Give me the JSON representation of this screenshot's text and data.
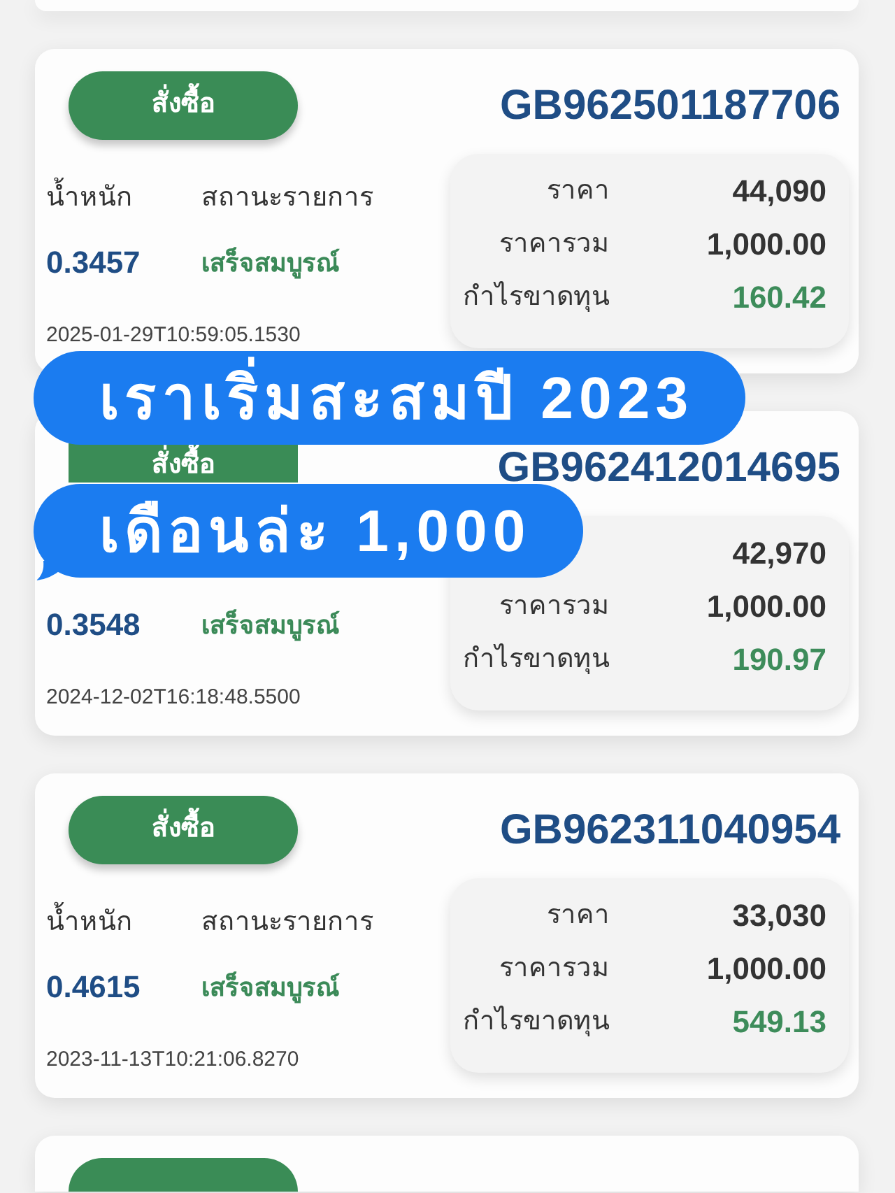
{
  "cards": [
    {
      "kind": "edge"
    },
    {
      "kind": "full",
      "button": "สั่งซื้อ",
      "order_id": "GB962501187706",
      "weight_label": "น้ำหนัก",
      "status_label": "สถานะรายการ",
      "weight": "0.3457",
      "status": "เสร็จสมบูรณ์",
      "timestamp": "2025-01-29T10:59:05.1530",
      "summary": [
        {
          "kind": "amount",
          "label": "ราคา",
          "value": "44,090"
        },
        {
          "kind": "amount",
          "label": "ราคารวม",
          "value": "1,000.00"
        },
        {
          "kind": "profit",
          "label": "กำไรขาดทุน",
          "value": "160.42"
        }
      ]
    },
    {
      "kind": "covered",
      "button": "สั่งซื้อ",
      "order_id": "GB962412014695",
      "weight": "0.3548",
      "status": "เสร็จสมบูรณ์",
      "timestamp": "2024-12-02T16:18:48.5500",
      "summary": [
        {
          "kind": "amount",
          "value": "42,970"
        },
        {
          "kind": "amount",
          "label": "ราคารวม",
          "value": "1,000.00"
        },
        {
          "kind": "profit",
          "label": "กำไรขาดทุน",
          "value": "190.97"
        }
      ]
    },
    {
      "kind": "full",
      "button": "สั่งซื้อ",
      "order_id": "GB962311040954",
      "weight_label": "น้ำหนัก",
      "status_label": "สถานะรายการ",
      "weight": "0.4615",
      "status": "เสร็จสมบูรณ์",
      "timestamp": "2023-11-13T10:21:06.8270",
      "summary": [
        {
          "kind": "amount",
          "label": "ราคา",
          "value": "33,030"
        },
        {
          "kind": "amount",
          "label": "ราคารวม",
          "value": "1,000.00"
        },
        {
          "kind": "profit",
          "label": "กำไรขาดทุน",
          "value": "549.13"
        }
      ]
    },
    {
      "kind": "peek"
    }
  ],
  "caption": {
    "lines": [
      "เราเริ่มสะสมปี 2023",
      "เดือนล่ะ 1,000"
    ]
  }
}
